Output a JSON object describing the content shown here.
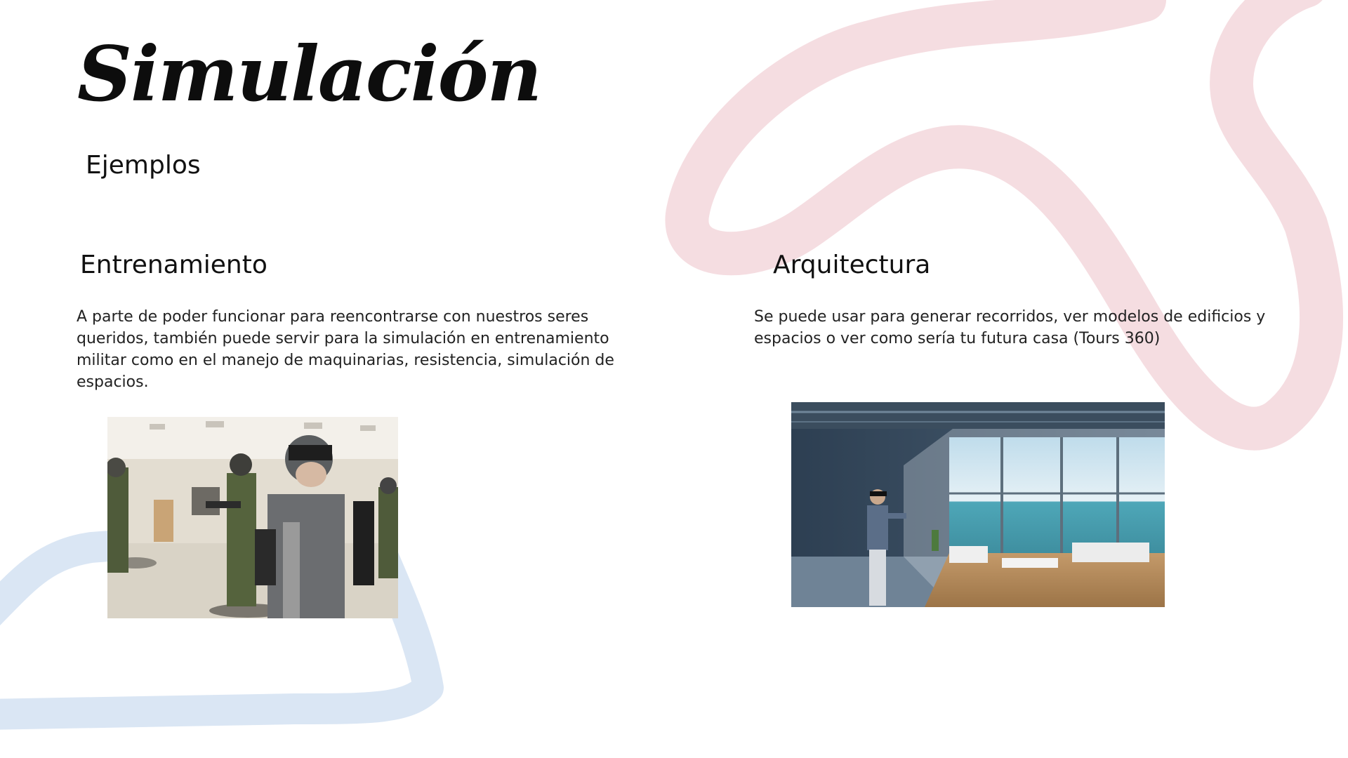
{
  "slide": {
    "title": "Simulación",
    "subtitle": "Ejemplos"
  },
  "sections": {
    "left": {
      "heading": "Entrenamiento",
      "text": "A parte de poder funcionar para reencontrarse con nuestros seres queridos, también puede servir para la simulación en entrenamiento militar como en el manejo de maquinarias, resistencia, simulación de espacios."
    },
    "right": {
      "heading": "Arquitectura",
      "text": "Se puede usar para generar recorridos, ver modelos de edificios y espacios o ver como sería tu futura casa (Tours 360)"
    }
  },
  "colors": {
    "pink_stroke": "#f5dde1",
    "blue_stroke": "#dae6f4",
    "text": "#111111"
  }
}
